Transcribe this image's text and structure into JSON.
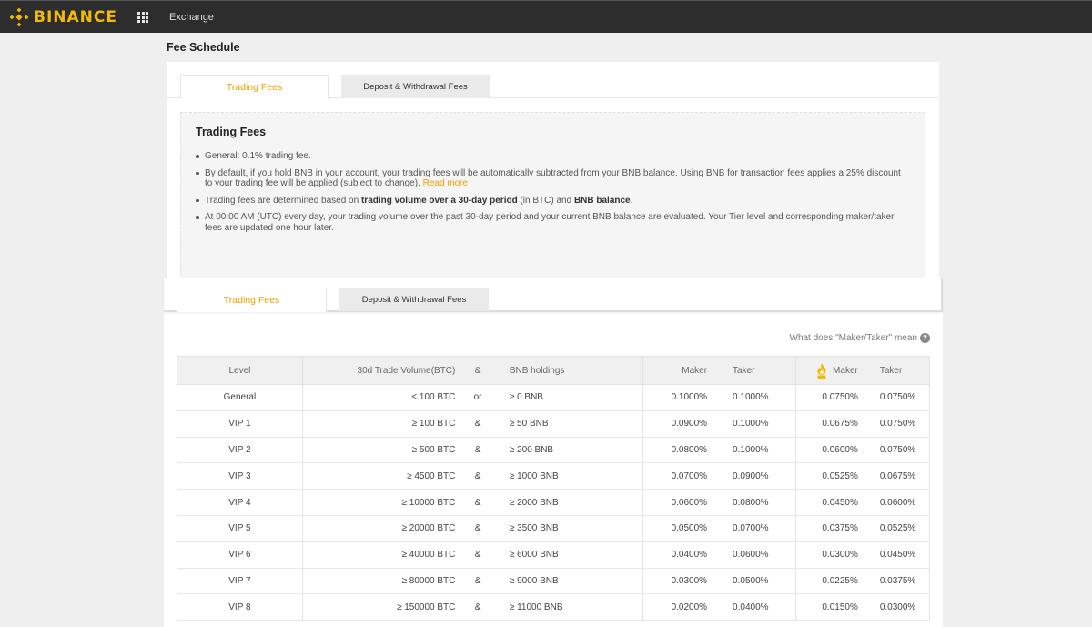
{
  "header": {
    "logo_text": "BINANCE",
    "nav_exchange": "Exchange",
    "brand_color": "#f0b90b"
  },
  "page": {
    "title": "Fee Schedule"
  },
  "tabs": {
    "trading_fees": "Trading Fees",
    "deposit_withdrawal_fees": "Deposit & Withdrawal Fees"
  },
  "trading_fees_panel": {
    "title": "Trading Fees",
    "bullet_1": "General: 0.1% trading fee.",
    "bullet_2": "By default, if you hold BNB in your account, your trading fees will be automatically subtracted from your BNB balance. Using BNB for transaction fees applies a 25% discount to your trading fee will be applied (subject to change).",
    "read_more": "Read more",
    "bullet_3_a": "Trading fees are determined based on ",
    "bullet_3_b": "trading volume over a 30-day period",
    "bullet_3_c": " (in BTC) and ",
    "bullet_3_d": "BNB balance",
    "bullet_3_e": ".",
    "bullet_4": "At 00:00 AM (UTC) every day, your trading volume over the past 30-day period and your current BNB balance are evaluated. Your Tier level and corresponding maker/taker fees are updated one hour later."
  },
  "faq": {
    "text": "What does \"Maker/Taker\" mean",
    "icon": "question-circle-icon"
  },
  "table": {
    "headers": {
      "level": "Level",
      "volume": "30d Trade Volume(BTC)",
      "op": "&",
      "bnb": "BNB holdings",
      "maker": "Maker",
      "taker": "Taker",
      "bnb_icon": "bnb-fire-icon",
      "bnb_maker": "Maker",
      "bnb_taker": "Taker"
    },
    "rows": [
      {
        "level": "General",
        "volume": "< 100 BTC",
        "op": "or",
        "bnb": "≥ 0 BNB",
        "maker": "0.1000%",
        "taker": "0.1000%",
        "bnb_maker": "0.0750%",
        "bnb_taker": "0.0750%"
      },
      {
        "level": "VIP 1",
        "volume": "≥ 100 BTC",
        "op": "&",
        "bnb": "≥ 50 BNB",
        "maker": "0.0900%",
        "taker": "0.1000%",
        "bnb_maker": "0.0675%",
        "bnb_taker": "0.0750%"
      },
      {
        "level": "VIP 2",
        "volume": "≥ 500 BTC",
        "op": "&",
        "bnb": "≥ 200 BNB",
        "maker": "0.0800%",
        "taker": "0.1000%",
        "bnb_maker": "0.0600%",
        "bnb_taker": "0.0750%"
      },
      {
        "level": "VIP 3",
        "volume": "≥ 4500 BTC",
        "op": "&",
        "bnb": "≥ 1000 BNB",
        "maker": "0.0700%",
        "taker": "0.0900%",
        "bnb_maker": "0.0525%",
        "bnb_taker": "0.0675%"
      },
      {
        "level": "VIP 4",
        "volume": "≥ 10000 BTC",
        "op": "&",
        "bnb": "≥ 2000 BNB",
        "maker": "0.0600%",
        "taker": "0.0800%",
        "bnb_maker": "0.0450%",
        "bnb_taker": "0.0600%"
      },
      {
        "level": "VIP 5",
        "volume": "≥ 20000 BTC",
        "op": "&",
        "bnb": "≥ 3500 BNB",
        "maker": "0.0500%",
        "taker": "0.0700%",
        "bnb_maker": "0.0375%",
        "bnb_taker": "0.0525%"
      },
      {
        "level": "VIP 6",
        "volume": "≥ 40000 BTC",
        "op": "&",
        "bnb": "≥ 6000 BNB",
        "maker": "0.0400%",
        "taker": "0.0600%",
        "bnb_maker": "0.0300%",
        "bnb_taker": "0.0450%"
      },
      {
        "level": "VIP 7",
        "volume": "≥ 80000 BTC",
        "op": "&",
        "bnb": "≥ 9000 BNB",
        "maker": "0.0300%",
        "taker": "0.0500%",
        "bnb_maker": "0.0225%",
        "bnb_taker": "0.0375%"
      },
      {
        "level": "VIP 8",
        "volume": "≥ 150000 BTC",
        "op": "&",
        "bnb": "≥ 11000 BNB",
        "maker": "0.0200%",
        "taker": "0.0400%",
        "bnb_maker": "0.0150%",
        "bnb_taker": "0.0300%"
      }
    ]
  }
}
